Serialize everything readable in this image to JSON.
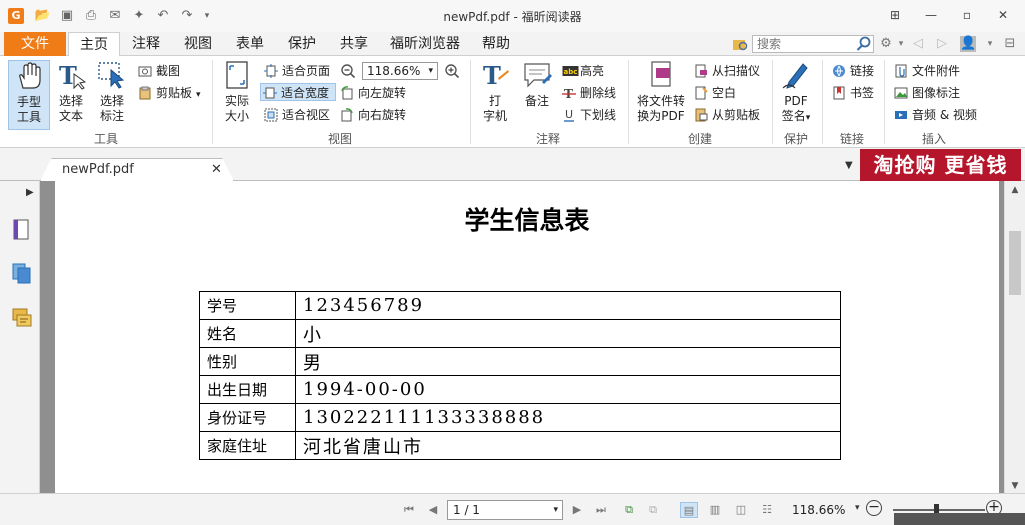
{
  "window": {
    "title": "newPdf.pdf - 福昕阅读器",
    "minimize": "—",
    "restore": "▫",
    "close": "✕"
  },
  "menu": {
    "file": "文件",
    "tabs": [
      "主页",
      "注释",
      "视图",
      "表单",
      "保护",
      "共享",
      "福昕浏览器",
      "帮助"
    ],
    "search_placeholder": "搜索"
  },
  "ribbon": {
    "tools": {
      "label": "工具",
      "hand": "手型\n工具",
      "select_text": "选择\n文本",
      "select_annot": "选择\n标注",
      "screenshot": "截图",
      "clipboard": "剪贴板"
    },
    "view": {
      "label": "视图",
      "actual_size": "实际\n大小",
      "fit_page": "适合页面",
      "fit_width": "适合宽度",
      "fit_visible": "适合视区",
      "zoom": "118.66%",
      "rotate_left": "向左旋转",
      "rotate_right": "向右旋转"
    },
    "comment": {
      "label": "注释",
      "typewriter": "打\n字机",
      "note": "备注",
      "highlight": "高亮",
      "strikeout": "删除线",
      "underline": "下划线"
    },
    "create": {
      "label": "创建",
      "convert": "将文件转\n换为PDF",
      "from_scanner": "从扫描仪",
      "blank": "空白",
      "from_clipboard": "从剪贴板"
    },
    "protect": {
      "label": "保护",
      "sign": "PDF\n签名"
    },
    "links": {
      "label": "链接",
      "link": "链接",
      "bookmark": "书签"
    },
    "insert": {
      "label": "插入",
      "attachment": "文件附件",
      "image": "图像标注",
      "av": "音频 & 视频"
    }
  },
  "doc_tab": {
    "name": "newPdf.pdf",
    "close": "✕"
  },
  "ad": {
    "text": "淘抢购 更省钱"
  },
  "document": {
    "title": "学生信息表",
    "rows": [
      {
        "label": "学号",
        "value": "123456789"
      },
      {
        "label": "姓名",
        "value": "小"
      },
      {
        "label": "性别",
        "value": "男"
      },
      {
        "label": "出生日期",
        "value": "1994-00-00"
      },
      {
        "label": "身份证号",
        "value": "130222111133338888"
      },
      {
        "label": "家庭住址",
        "value": "河北省唐山市"
      }
    ]
  },
  "status": {
    "page": "1 / 1",
    "zoom": "118.66%"
  },
  "colors": {
    "accent": "#f07c17",
    "selected": "#cfe4f7",
    "ad": "#b5162b"
  }
}
